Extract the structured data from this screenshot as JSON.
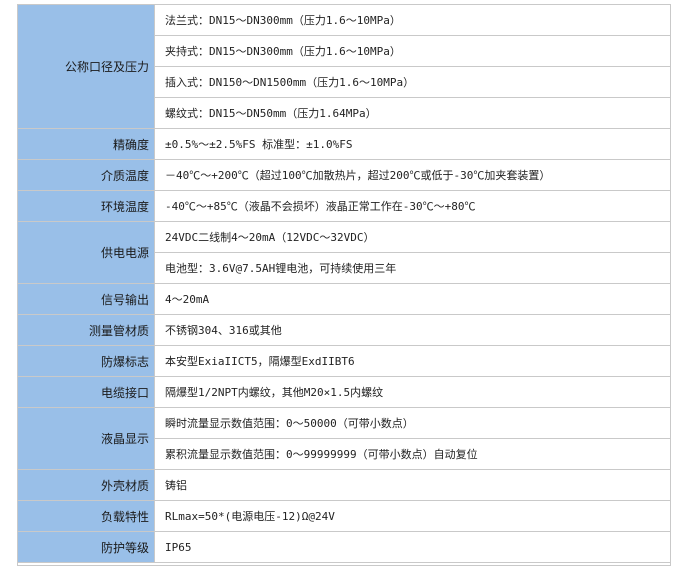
{
  "rows": [
    {
      "label": "公称口径及压力",
      "values": [
        "法兰式：DN15～DN300mm（压力1.6～10MPa）",
        "夹持式：DN15～DN300mm（压力1.6～10MPa）",
        "插入式：DN150～DN1500mm（压力1.6～10MPa）",
        "螺纹式：DN15～DN50mm（压力1.64MPa）"
      ]
    },
    {
      "label": "精确度",
      "values": [
        "±0.5%～±2.5%FS 标准型：±1.0%FS"
      ]
    },
    {
      "label": "介质温度",
      "values": [
        "－40℃～+200℃（超过100℃加散热片，超过200℃或低于-30℃加夹套装置）"
      ]
    },
    {
      "label": "环境温度",
      "values": [
        "-40℃～+85℃（液晶不会损坏）液晶正常工作在-30℃～+80℃"
      ]
    },
    {
      "label": "供电电源",
      "values": [
        "24VDC二线制4～20mA（12VDC～32VDC）",
        "电池型：3.6V@7.5AH锂电池，可持续使用三年"
      ]
    },
    {
      "label": "信号输出",
      "values": [
        "4～20mA"
      ]
    },
    {
      "label": "测量管材质",
      "values": [
        "不锈钢304、316或其他"
      ]
    },
    {
      "label": "防爆标志",
      "values": [
        "本安型ExiaIICT5，隔爆型ExdIIBT6"
      ]
    },
    {
      "label": "电缆接口",
      "values": [
        "隔爆型1/2NPT内螺纹，其他M20×1.5内螺纹"
      ]
    },
    {
      "label": "液晶显示",
      "values": [
        "瞬时流量显示数值范围：0～50000（可带小数点）",
        "累积流量显示数值范围：0～99999999（可带小数点）自动复位"
      ]
    },
    {
      "label": "外壳材质",
      "values": [
        "铸铝"
      ]
    },
    {
      "label": "负载特性",
      "values": [
        "RLmax=50*(电源电压-12)Ω@24V"
      ]
    },
    {
      "label": "防护等级",
      "values": [
        "IP65"
      ]
    }
  ]
}
